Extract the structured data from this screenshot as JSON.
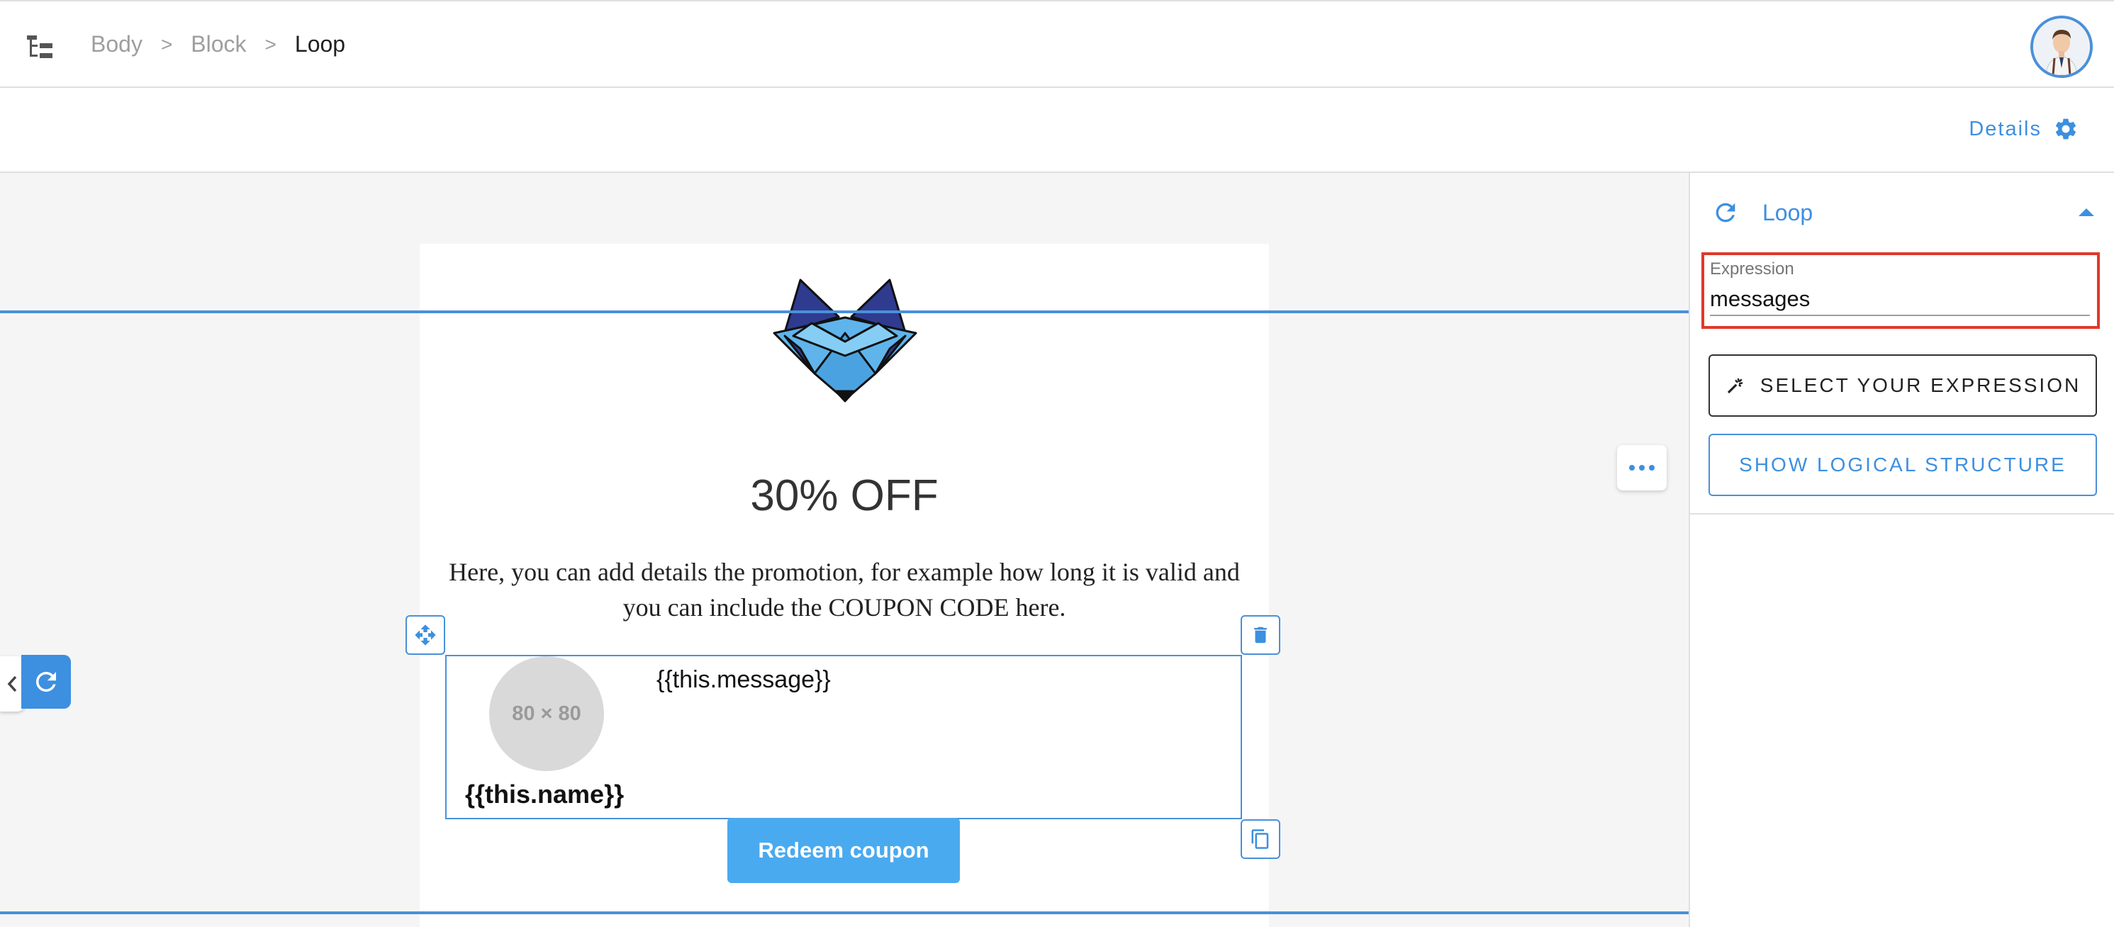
{
  "breadcrumb": {
    "items": [
      "Body",
      "Block",
      "Loop"
    ],
    "separator": ">"
  },
  "header": {
    "details_label": "Details"
  },
  "email": {
    "headline": "30% OFF",
    "promo_text": "Here, you can add details  the promotion, for example how long it is valid and you can include the COUPON CODE here.",
    "loop_item": {
      "image_placeholder": "80 × 80",
      "message": "{{this.message}}",
      "name": "{{this.name}}"
    },
    "cta_label": "Redeem coupon"
  },
  "panel": {
    "title": "Loop",
    "expression_label": "Expression",
    "expression_value": "messages",
    "select_expression_label": "SELECT YOUR EXPRESSION",
    "show_structure_label": "SHOW LOGICAL STRUCTURE"
  },
  "colors": {
    "accent": "#3d8fe0",
    "cta": "#4aaaf0",
    "highlight": "#e0392b",
    "canvas_bg": "#f5f5f5"
  },
  "icons": [
    "tree-icon",
    "avatar",
    "gear-icon",
    "more-icon",
    "move-icon",
    "trash-icon",
    "copy-icon",
    "chevron-left-icon",
    "refresh-icon",
    "caret-up-icon",
    "magic-wand-icon"
  ]
}
